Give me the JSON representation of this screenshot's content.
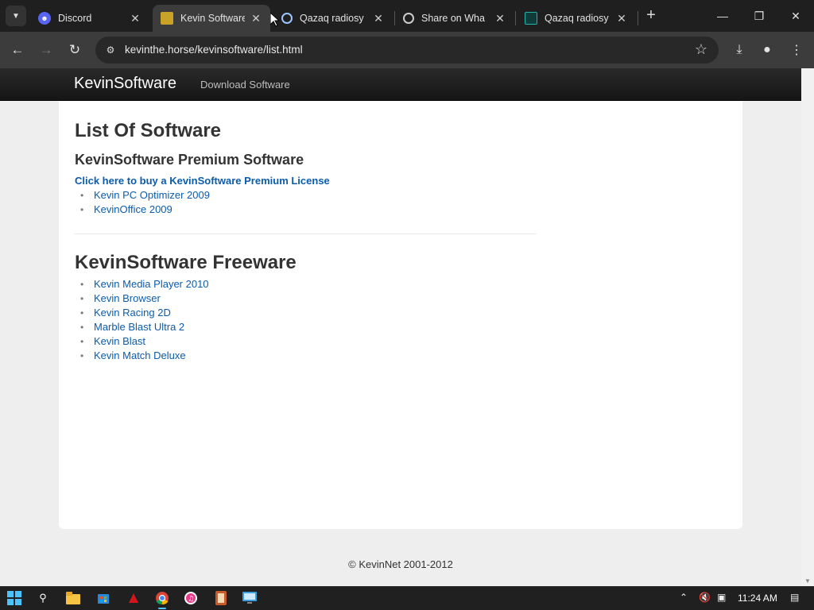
{
  "browser": {
    "tabs": [
      {
        "title": "Discord",
        "icon": "discord-icon",
        "color": "#5865f2"
      },
      {
        "title": "Kevin Software",
        "icon": "kevin-favicon",
        "color": "#c9a227",
        "active": true
      },
      {
        "title": "Qazaq radiosy",
        "icon": "radio-icon",
        "color": "#9ec5ff"
      },
      {
        "title": "Share on Wha",
        "icon": "globe-icon",
        "color": "#cccccc"
      },
      {
        "title": "Qazaq radiosy",
        "icon": "radio-icon",
        "color": "#1fb5a8"
      }
    ],
    "url": "kevinthe.horse/kevinsoftware/list.html"
  },
  "site": {
    "brand": "KevinSoftware",
    "nav_link": "Download Software",
    "title": "List Of Software",
    "premium_heading": "KevinSoftware Premium Software",
    "buy_link": "Click here to buy a KevinSoftware Premium License",
    "premium_items": [
      "Kevin PC Optimizer 2009",
      "KevinOffice 2009"
    ],
    "freeware_heading": "KevinSoftware Freeware",
    "freeware_items": [
      "Kevin Media Player 2010",
      "Kevin Browser",
      "Kevin Racing 2D",
      "Marble Blast Ultra 2",
      "Kevin Blast",
      "Kevin Match Deluxe"
    ],
    "footer": "© KevinNet 2001-2012"
  },
  "taskbar": {
    "time": "11:24 AM"
  },
  "colors": {
    "link": "#0b5cad",
    "accent": "#4cc2ff"
  }
}
